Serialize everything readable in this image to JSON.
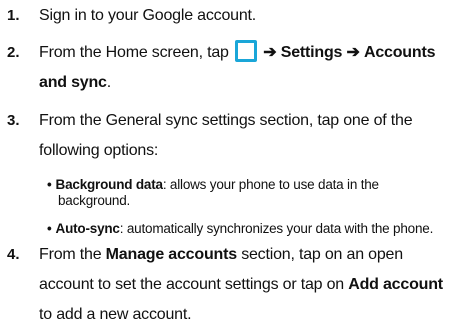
{
  "steps": [
    {
      "number": "1.",
      "text": "Sign in to your Google account."
    },
    {
      "number": "2.",
      "pre": "From the Home screen, tap",
      "arrow1": "➔",
      "settings": "Settings",
      "arrow2": "➔",
      "accounts": "Accounts",
      "accounts2": "and sync",
      "end": "."
    },
    {
      "number": "3.",
      "line1": "From the General sync settings section, tap one of the",
      "line2": "following options:"
    },
    {
      "number": "4.",
      "pre": "From the",
      "manage": "Manage accounts",
      "line1_rest": "section, tap on an open",
      "line2": "account to set the account settings or tap on",
      "add": "Add account",
      "line3": "to add a new account."
    }
  ],
  "bullets": [
    {
      "dot": "•",
      "term": "Background data",
      "desc1": ": allows your phone to use data in the",
      "desc2": "background."
    },
    {
      "dot": "•",
      "term": "Auto-sync",
      "desc": ": automatically synchronizes your data with the phone."
    }
  ],
  "icons": {
    "apps": "apps-grid-icon",
    "apps_color": "#1aa6d8"
  }
}
